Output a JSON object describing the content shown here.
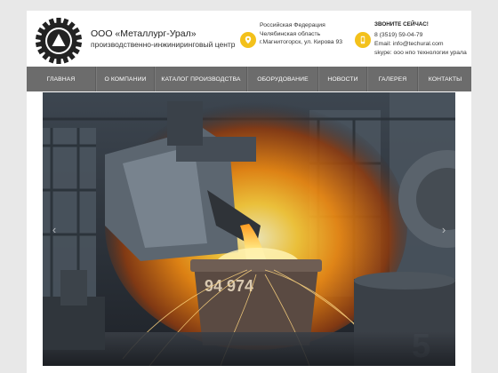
{
  "header": {
    "company_name": "ООО «Металлург-Урал»",
    "company_subtitle": "производственно-инжиниринговый центр",
    "address": {
      "line1": "Российская Федерация",
      "line2": "Челябинская область",
      "line3": "г.Магнитогорск, ул. Кирова 93"
    },
    "contacts": {
      "call_label": "ЗВОНИТЕ СЕЙЧАС!",
      "phone": "8 (3519) 59-04-79",
      "email": "Email: info@techural.com",
      "skype": "skype: ооо нпо технологии урала"
    },
    "icons": [
      "location-pin-icon",
      "mobile-phone-icon"
    ],
    "accent_color": "#f3c11b"
  },
  "nav": {
    "items": [
      {
        "label": "ГЛАВНАЯ"
      },
      {
        "label": "О КОМПАНИИ"
      },
      {
        "label": "КАТАЛОГ ПРОИЗВОДСТВА"
      },
      {
        "label": "ОБОРУДОВАНИЕ"
      },
      {
        "label": "НОВОСТИ"
      },
      {
        "label": "ГАЛЕРЕЯ"
      },
      {
        "label": "КОНТАКТЫ"
      }
    ],
    "background_color": "#6c6c6c"
  },
  "slider": {
    "image": "steel-pouring-foundry-photo",
    "ladle_marking": "94 974",
    "column_number": "5",
    "prev_icon": "chevron-left-icon",
    "next_icon": "chevron-right-icon"
  }
}
